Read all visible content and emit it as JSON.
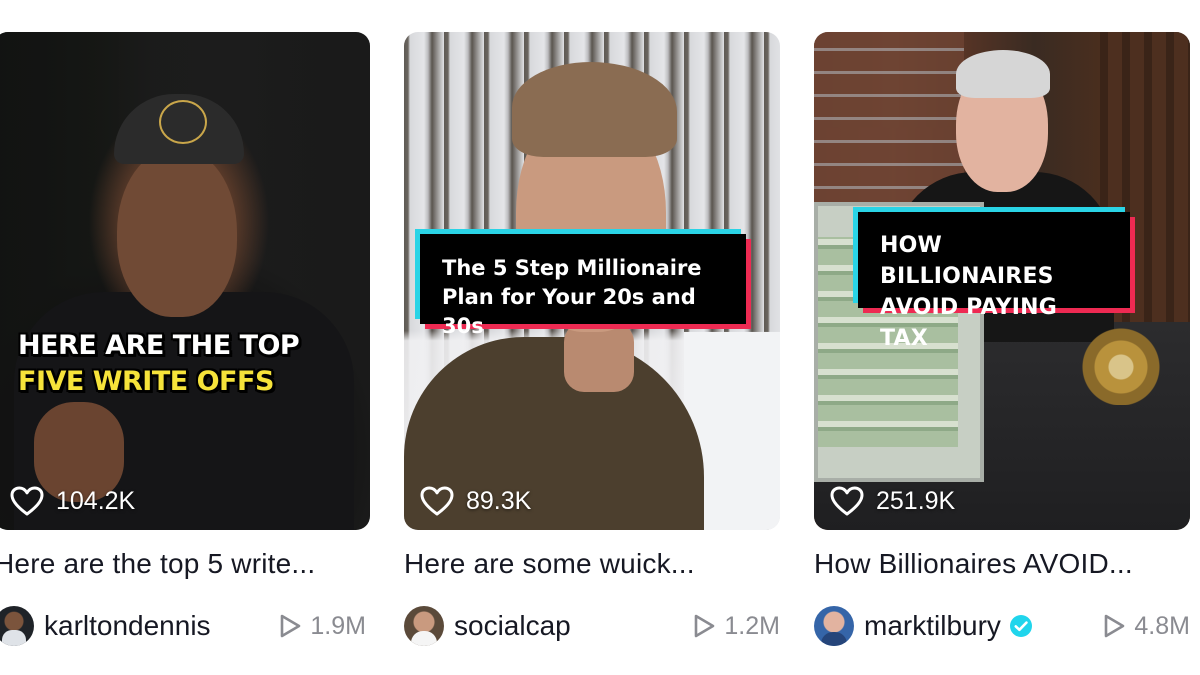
{
  "videos": [
    {
      "overlay_line1": "HERE ARE THE TOP",
      "overlay_line2": "FIVE WRITE OFFS",
      "likes": "104.2K",
      "title": "Here are the top 5 write...",
      "username": "karltondennis",
      "verified": false,
      "views": "1.9M"
    },
    {
      "overlay_caption": "The 5 Step Millionaire Plan for Your 20s and 30s",
      "likes": "89.3K",
      "title": "Here are some wuick...",
      "username": "socialcap",
      "verified": false,
      "views": "1.2M"
    },
    {
      "overlay_caption": "HOW BILLIONAIRES AVOID PAYING TAX",
      "likes": "251.9K",
      "title": "How Billionaires AVOID...",
      "username": "marktilbury",
      "verified": true,
      "views": "4.8M"
    }
  ],
  "icons": {
    "like": "heart-outline-icon",
    "views": "play-outline-icon",
    "verified": "verified-badge-icon"
  },
  "colors": {
    "text_primary": "#161823",
    "text_secondary": "#8a8b91",
    "verified": "#20d5ec",
    "overlay_highlight": "#f6e33a",
    "tiktok_red": "#ee2a52",
    "tiktok_cyan": "#2ad4e6"
  }
}
